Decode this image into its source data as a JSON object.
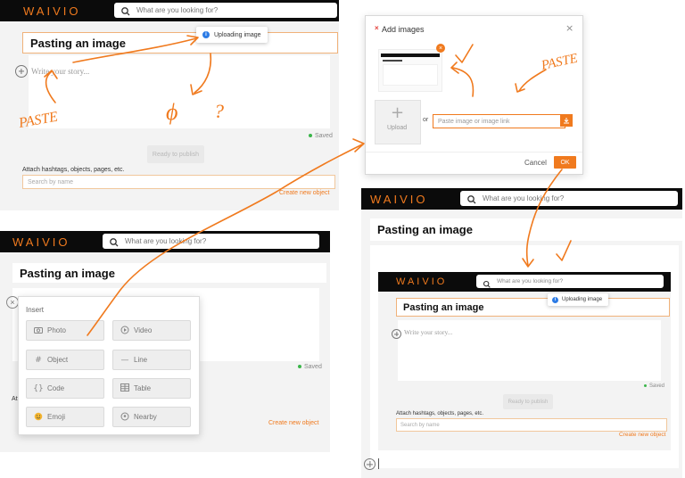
{
  "logo_text": "WAIVIO",
  "search_placeholder": "What are you looking for?",
  "post_title": "Pasting an image",
  "story_placeholder": "Write your story...",
  "uploading_text": "Uploading image",
  "saved_text": "Saved",
  "publish_label": "Ready to publish",
  "attach_hint": "Attach hashtags, objects, pages, etc.",
  "search_by_name": "Search by name",
  "create_object": "Create new object",
  "modal": {
    "title": "Add images",
    "upload_label": "Upload",
    "or_text": "or",
    "paste_placeholder": "Paste image or image link",
    "cancel_label": "Cancel",
    "ok_label": "OK"
  },
  "insert_menu": {
    "title": "Insert",
    "items": [
      {
        "label": "Photo",
        "icon": "camera-icon"
      },
      {
        "label": "Video",
        "icon": "play-icon"
      },
      {
        "label": "Object",
        "icon": "hash-icon"
      },
      {
        "label": "Line",
        "icon": "dash-icon"
      },
      {
        "label": "Code",
        "icon": "braces-icon"
      },
      {
        "label": "Table",
        "icon": "grid-icon"
      },
      {
        "label": "Emoji",
        "icon": "smiley-icon"
      },
      {
        "label": "Nearby",
        "icon": "location-icon"
      }
    ]
  },
  "annotations": {
    "paste_left": "PASTE",
    "paste_right": "PASTE",
    "phi": "ϕ",
    "question": "?"
  },
  "colors": {
    "brand": "#f07a1e",
    "topbar": "#0b0b0b",
    "panel_bg": "#f3f3f3",
    "saved_dot": "#3bb54a",
    "info_blue": "#2c7be5",
    "annotation": "#f07a1e"
  }
}
